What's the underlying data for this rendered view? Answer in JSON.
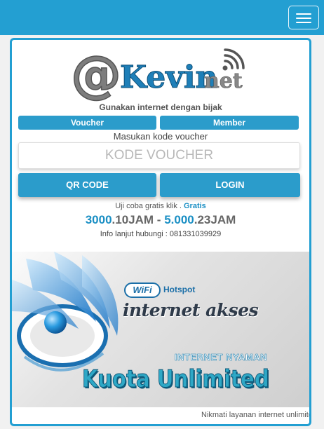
{
  "header": {
    "menu_icon": "hamburger-icon"
  },
  "brand": {
    "logo_text": "@Kevinnet",
    "logo_at": "@",
    "logo_kevin": "Kevin",
    "logo_net": "net",
    "logo_icon": "wifi-signal-icon"
  },
  "tagline": "Gunakan internet dengan bijak",
  "tabs": [
    {
      "label": "Voucher"
    },
    {
      "label": "Member"
    }
  ],
  "prompt": "Masukan kode voucher",
  "code_input": {
    "placeholder": "KODE VOUCHER",
    "value": ""
  },
  "buttons": {
    "qr": "QR CODE",
    "login": "LOGIN"
  },
  "trial": {
    "text": "Uji coba gratis klik . ",
    "link": "Gratis"
  },
  "prices": {
    "p1_num": "3000",
    "p1_unit": ".10JAM",
    "sep": " - ",
    "p2_num": "5.000",
    "p2_unit": ".23JAM"
  },
  "info": "Info lanjut hubungi : 081331039929",
  "banner": {
    "wifi_badge": "WiFi",
    "hotspot": "Hotspot",
    "headline": "internet akses",
    "tagline": "INTERNET NYAMAN",
    "title": "Kuota Unlimited"
  },
  "marquee": "Nikmati layanan internet unlimited",
  "colors": {
    "accent": "#239fd2",
    "button": "#2b9ccb",
    "link": "#1a8fc4"
  }
}
